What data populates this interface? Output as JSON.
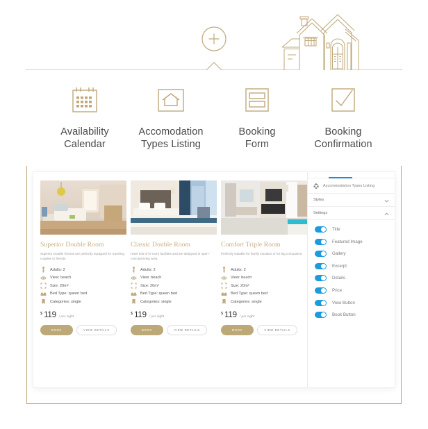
{
  "palette": {
    "gold": "#bfa87a",
    "gold_text": "#c6ad80",
    "toggle_on": "#1e9bdd",
    "tab_accent": "#1e88e5",
    "label_gray": "#4a4a4a"
  },
  "illustration": {
    "plus_icon": "plus-circle-icon",
    "house_icon": "house-line-art-icon"
  },
  "features": [
    {
      "icon": "calendar-icon",
      "label": "Availability\nCalendar",
      "line1": "Availability",
      "line2": "Calendar"
    },
    {
      "icon": "house-in-box-icon",
      "label": "Accomodation Types Listing",
      "line1": "Accomodation",
      "line2": "Types Listing"
    },
    {
      "icon": "form-icon",
      "label": "Booking Form",
      "line1": "Booking",
      "line2": "Form"
    },
    {
      "icon": "checkmark-box-icon",
      "label": "Booking Confirmation",
      "line1": "Booking",
      "line2": "Confirmation"
    }
  ],
  "cards": [
    {
      "image_alt": "superior-double-room-photo",
      "title": "Superior Double Room",
      "description": "Superior Double Rooms are perfectly equipped for traveling couples or friends.",
      "specs": [
        {
          "icon": "person-icon",
          "text": "Adults: 2"
        },
        {
          "icon": "eye-icon",
          "text": "View: beach"
        },
        {
          "icon": "resize-icon",
          "text": "Size: 20m²"
        },
        {
          "icon": "bed-icon",
          "text": "Bed Type: queen bed"
        },
        {
          "icon": "bookmark-icon",
          "text": "Categories: single"
        }
      ],
      "price_currency": "$",
      "price_value": "119",
      "price_unit": "/ per night",
      "book_label": "BOOK",
      "view_label": "VIEW DETAILS"
    },
    {
      "image_alt": "classic-double-room-photo",
      "title": "Classic Double Room",
      "description": "Have lots of in-room facilities and are designed in open-concept living area.",
      "specs": [
        {
          "icon": "person-icon",
          "text": "Adults: 2"
        },
        {
          "icon": "eye-icon",
          "text": "View: beach"
        },
        {
          "icon": "resize-icon",
          "text": "Size: 20m²"
        },
        {
          "icon": "bed-icon",
          "text": "Bed Type: queen bed"
        },
        {
          "icon": "bookmark-icon",
          "text": "Categories: single"
        }
      ],
      "price_currency": "$",
      "price_value": "119",
      "price_unit": "/ per night",
      "book_label": "BOOK",
      "view_label": "VIEW DETAILS"
    },
    {
      "image_alt": "comfort-triple-room-photo",
      "title": "Comfort Triple Room",
      "description": "Perfectly suitable for family vacation or for big companies.",
      "specs": [
        {
          "icon": "person-icon",
          "text": "Adults: 2"
        },
        {
          "icon": "eye-icon",
          "text": "View: beach"
        },
        {
          "icon": "resize-icon",
          "text": "Size: 20m²"
        },
        {
          "icon": "bed-icon",
          "text": "Bed Type: queen bed"
        },
        {
          "icon": "bookmark-icon",
          "text": "Categories: single"
        }
      ],
      "price_currency": "$",
      "price_value": "119",
      "price_unit": "/ per night",
      "book_label": "BOOK",
      "view_label": "VIEW DETAILS"
    }
  ],
  "panel": {
    "widget_icon": "widget-icon",
    "widget_title": "Accommodation Types Listing",
    "sections": [
      {
        "label": "Styles",
        "state": "collapsed",
        "chevron": "chevron-down-icon"
      },
      {
        "label": "Settings",
        "state": "expanded",
        "chevron": "chevron-up-icon"
      }
    ],
    "toggles": [
      {
        "label": "Title",
        "on": true
      },
      {
        "label": "Featured Image",
        "on": true
      },
      {
        "label": "Gallery",
        "on": true
      },
      {
        "label": "Excerpt",
        "on": true
      },
      {
        "label": "Details",
        "on": true
      },
      {
        "label": "Price",
        "on": true
      },
      {
        "label": "View Button",
        "on": true
      },
      {
        "label": "Book Button",
        "on": true
      }
    ]
  }
}
